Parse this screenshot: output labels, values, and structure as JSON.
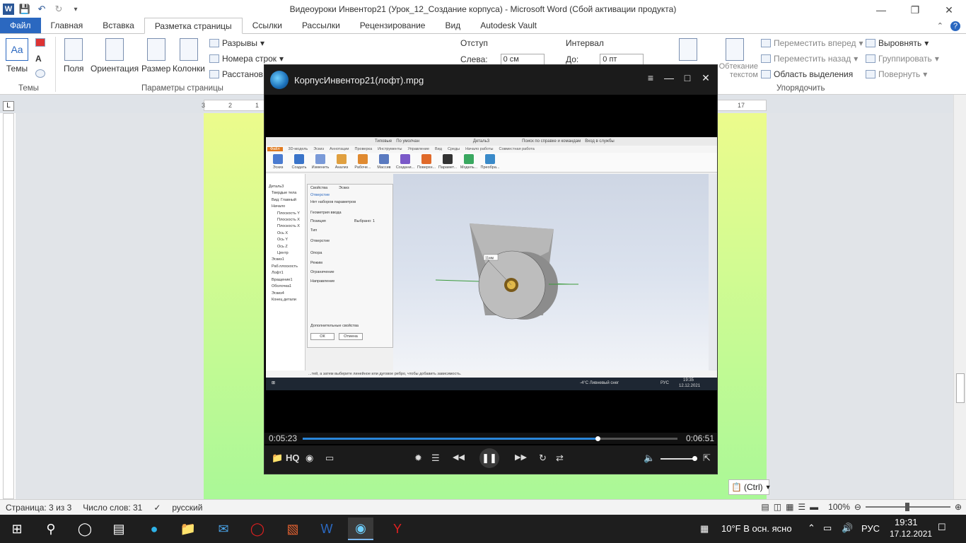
{
  "window": {
    "title": "Видеоуроки Инвентор21 (Урок_12_Создание корпуса)  -  Microsoft Word (Сбой активации продукта)"
  },
  "ribbon_tabs": [
    "Файл",
    "Главная",
    "Вставка",
    "Разметка страницы",
    "Ссылки",
    "Рассылки",
    "Рецензирование",
    "Вид",
    "Autodesk Vault"
  ],
  "ribbon": {
    "themes": {
      "label": "Темы",
      "group": "Темы"
    },
    "page_setup": {
      "group": "Параметры страницы",
      "fields": "Поля",
      "orientation": "Ориентация",
      "size": "Размер",
      "columns": "Колонки",
      "breaks": "Разрывы",
      "line_numbers": "Номера строк",
      "hyphenation": "Расстанов"
    },
    "indent": {
      "label": "Отступ",
      "left_label": "Слева:",
      "left_value": "0 см"
    },
    "spacing": {
      "label": "Интервал",
      "before_label": "До:",
      "before_value": "0 пт"
    },
    "wrap": "Обтекание текстом",
    "arrange": {
      "group": "Упорядочить",
      "bring_forward": "Переместить вперед",
      "send_backward": "Переместить назад",
      "selection_pane": "Область выделения",
      "align": "Выровнять",
      "group_btn": "Группировать",
      "rotate": "Повернуть"
    }
  },
  "ruler": {
    "marks": [
      "3",
      "2",
      "1",
      "17"
    ]
  },
  "paste_options": "(Ctrl)",
  "status": {
    "page": "Страница: 3 из 3",
    "words": "Число слов: 31",
    "language": "русский",
    "zoom": "100%"
  },
  "player": {
    "title": "КорпусИнвентор21(лофт).mpg",
    "elapsed": "0:05:23",
    "total": "0:06:51",
    "progress": 0.786,
    "volume": 0.95,
    "hq": "HQ",
    "inventor": {
      "top_items": [
        "Типовые",
        "По умолчан",
        "Деталь3",
        "Поиск по справке и командам",
        "Вход в службы"
      ],
      "tabs": [
        "Файл",
        "3D-модель",
        "Эскиз",
        "Аннотации",
        "Проверка",
        "Инструменты",
        "Управление",
        "Вид",
        "Среды",
        "Начало работы",
        "Совместная работа"
      ],
      "tools": [
        "Эскиз",
        "Создать",
        "Изменить",
        "Анализ",
        "Рабоче...",
        "Массив",
        "Создани...",
        "Поверхн...",
        "Парамет...",
        "Модель...",
        "Преобра..."
      ],
      "browser": [
        "Деталь3",
        "Твердые тела",
        "Вид: Главный",
        "Начало",
        "Плоскость Y",
        "Плоскость X",
        "Плоскость X",
        "Ось X",
        "Ось Y",
        "Ось Z",
        "Центр",
        "Эскиз1",
        "Раб.плоскость",
        "Лофт1",
        "Вращение1",
        "Оболочка1",
        "Эскиз4",
        "Конец детали"
      ],
      "props": {
        "header": "Свойства",
        "tab": "Эскиз",
        "breadcrumb": "Отверстие",
        "preset": "Нет наборов параметров",
        "geometry": "Геометрия ввода",
        "position": "Позиция",
        "selected": "Выбрано: 1",
        "type": "Тип",
        "hole": "Отверстие",
        "seat": "Опора",
        "mode": "Режим",
        "limit": "Ограничение",
        "direction": "Направление",
        "extra": "Дополнительные свойства",
        "ok": "ОК",
        "cancel": "Отмена"
      },
      "dimension_label": "11мм",
      "status_text": "...тей, а затем выберите линейное или дуговое ребро, чтобы добавить зависимость.",
      "taskbar_weather": "-4°C  Ливневый снег",
      "taskbar_lang": "РУС",
      "taskbar_time": "19:35",
      "taskbar_date": "12.12.2021"
    }
  },
  "taskbar": {
    "weather": "10°F  В осн. ясно",
    "lang": "РУС",
    "time": "19:31",
    "date": "17.12.2021"
  },
  "colors": {
    "word_blue": "#2b68c0",
    "page_gradient_top": "#ecfb8c",
    "page_gradient_bottom": "#aaf897",
    "player_progress": "#2a86d9"
  }
}
